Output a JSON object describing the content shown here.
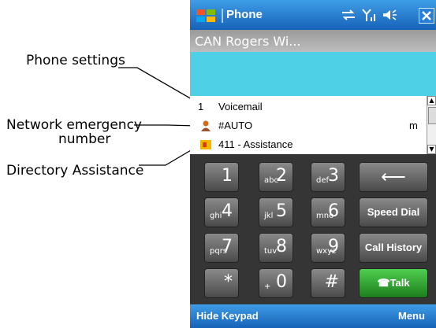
{
  "callouts": {
    "phone_settings": "Phone settings",
    "network_emergency_1": "Network emergency",
    "network_emergency_2": "number",
    "directory_assistance": "Directory Assistance"
  },
  "titlebar": {
    "title": "Phone",
    "status_icons": [
      "connectivity-icon",
      "signal-icon",
      "speaker-icon"
    ],
    "close": "x-icon"
  },
  "carrier": {
    "text": "CAN Rogers Wi..."
  },
  "list": [
    {
      "number": "1",
      "label": "Voicemail"
    },
    {
      "icon": "contact-icon",
      "label": "#AUTO",
      "right": "m"
    },
    {
      "icon": "assistance-icon",
      "label": "411 - Assistance"
    }
  ],
  "keypad": {
    "keys": [
      {
        "digit": "1",
        "sub": ""
      },
      {
        "digit": "2",
        "sub": "abc"
      },
      {
        "digit": "3",
        "sub": "def"
      },
      {
        "digit": "4",
        "sub": "ghi"
      },
      {
        "digit": "5",
        "sub": "jkl"
      },
      {
        "digit": "6",
        "sub": "mno"
      },
      {
        "digit": "7",
        "sub": "pqrs"
      },
      {
        "digit": "8",
        "sub": "tuv"
      },
      {
        "digit": "9",
        "sub": "wxyz"
      },
      {
        "digit": "*",
        "sub": ""
      },
      {
        "digit": "0",
        "sub": "+"
      },
      {
        "digit": "#",
        "sub": ""
      }
    ],
    "backspace": "⟵",
    "speed_dial": "Speed Dial",
    "call_history": "Call History",
    "talk": "Talk"
  },
  "softkeys": {
    "left": "Hide Keypad",
    "right": "Menu"
  },
  "colors": {
    "titlebar": "#2a7fd8",
    "dial_area": "#4ed0e6",
    "talk": "#2e9e2e"
  }
}
